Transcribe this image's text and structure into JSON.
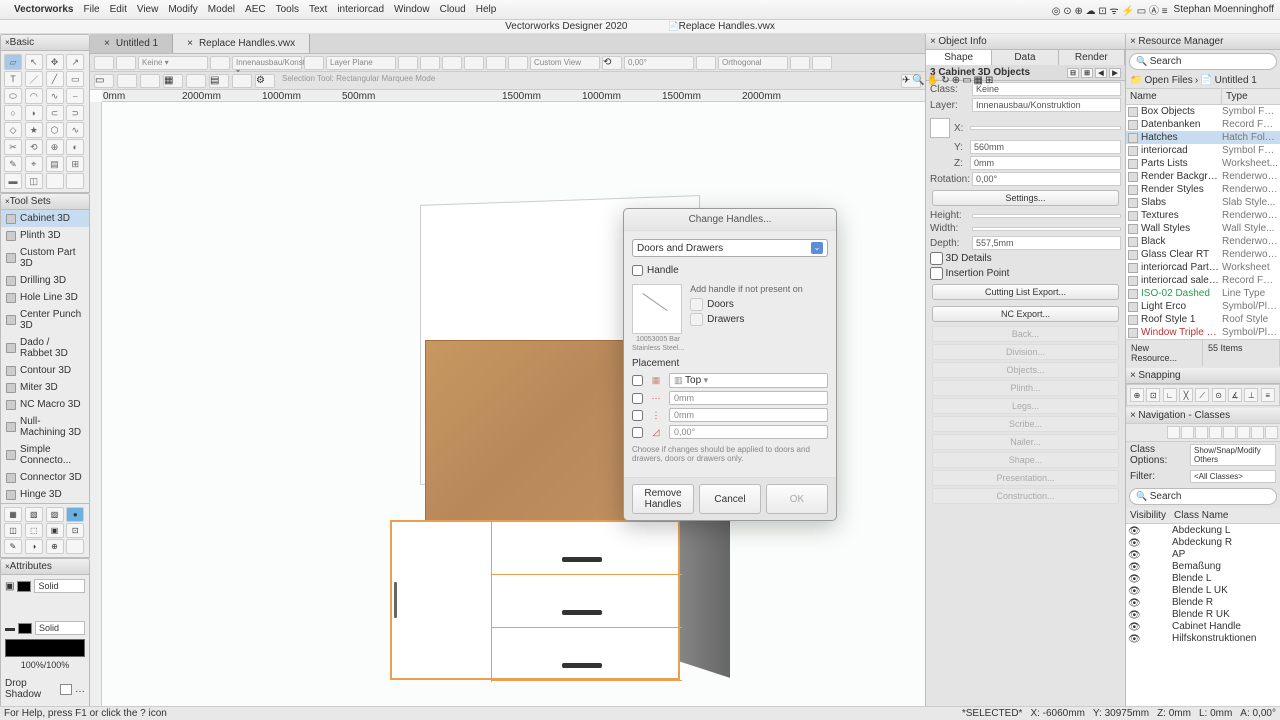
{
  "menubar": {
    "app": "Vectorworks",
    "items": [
      "File",
      "Edit",
      "View",
      "Modify",
      "Model",
      "AEC",
      "Tools",
      "Text",
      "interiorcad",
      "Window",
      "Cloud",
      "Help"
    ],
    "user": "Stephan Moenninghoff"
  },
  "titlebar": "Vectorworks Designer 2020",
  "doc_tab_title": "Replace Handles.vwx",
  "basic_palette": {
    "title": "Basic"
  },
  "toolsets": {
    "title": "Tool Sets",
    "items": [
      "Cabinet 3D",
      "Plinth 3D",
      "Custom Part 3D",
      "Drilling 3D",
      "Hole Line 3D",
      "Center Punch 3D",
      "Dado / Rabbet 3D",
      "Contour 3D",
      "Miter 3D",
      "NC Macro 3D",
      "Null-Machining 3D",
      "Simple Connecto...",
      "Connector 3D",
      "Hinge 3D"
    ]
  },
  "attributes": {
    "title": "Attributes",
    "fill": "Solid",
    "stroke": "Solid",
    "opacity": "100%/100%",
    "dropshadow": "Drop Shadow"
  },
  "tabs": [
    {
      "label": "Untitled 1"
    },
    {
      "label": "Replace Handles.vwx"
    }
  ],
  "toolbar": {
    "mode": "Selection Tool: Rectangular Marquee Mode",
    "layer_plane": "Layer Plane",
    "custom_view": "Custom View",
    "angle": "0,00°",
    "ortho": "Orthogonal"
  },
  "ruler_marks": [
    "0mm",
    "2000mm",
    "1000mm",
    "500mm",
    "1500mm",
    "1000mm",
    "1500mm",
    "2000mm"
  ],
  "dialog": {
    "title": "Change Handles...",
    "select": "Doors and Drawers",
    "handle_chk": "Handle",
    "thumb_caption1": "10053005 Bar",
    "thumb_caption2": "Stainless Steel...",
    "add_label": "Add handle if not present on",
    "opt_doors": "Doors",
    "opt_drawers": "Drawers",
    "placement": "Placement",
    "pos": "Top",
    "v1": "0mm",
    "v2": "0mm",
    "v3": "0,00°",
    "note": "Choose if changes should be applied to doors and drawers, doors or drawers only.",
    "btn_remove": "Remove Handles",
    "btn_cancel": "Cancel",
    "btn_ok": "OK"
  },
  "objinfo": {
    "title": "Object Info",
    "tabs": [
      "Shape",
      "Data",
      "Render"
    ],
    "header": "3 Cabinet 3D Objects",
    "class_k": "Class:",
    "class_v": "Keine",
    "layer_k": "Layer:",
    "layer_v": "Innenausbau/Konstruktion",
    "x_k": "X:",
    "x_v": "",
    "y_k": "Y:",
    "y_v": "560mm",
    "z_k": "Z:",
    "z_v": "0mm",
    "rot_k": "Rotation:",
    "rot_v": "0,00°",
    "settings": "Settings...",
    "h_k": "Height:",
    "w_k": "Width:",
    "d_k": "Depth:",
    "d_v": "557,5mm",
    "details": "3D Details",
    "insertion": "Insertion Point",
    "btn1": "Cutting List Export...",
    "btn2": "NC Export...",
    "grey": [
      "Back...",
      "Division...",
      "Objects...",
      "Plinth...",
      "Legs...",
      "Scribe...",
      "Nailer...",
      "Shape...",
      "Presentation...",
      "Construction..."
    ]
  },
  "resmgr": {
    "title": "Resource Manager",
    "search_ph": "Search",
    "crumb1": "Open Files",
    "crumb2": "Untitled 1",
    "col_name": "Name",
    "col_type": "Type",
    "items": [
      {
        "n": "Box Objects",
        "t": "Symbol Fol..."
      },
      {
        "n": "Datenbanken",
        "t": "Record For..."
      },
      {
        "n": "Hatches",
        "t": "Hatch Folder",
        "sel": true
      },
      {
        "n": "interiorcad",
        "t": "Symbol Fol..."
      },
      {
        "n": "Parts Lists",
        "t": "Worksheet..."
      },
      {
        "n": "Render Backgrounds",
        "t": "Renderwor..."
      },
      {
        "n": "Render Styles",
        "t": "Renderwor..."
      },
      {
        "n": "Slabs",
        "t": "Slab Style..."
      },
      {
        "n": "Textures",
        "t": "Renderwor..."
      },
      {
        "n": "Wall Styles",
        "t": "Wall Style..."
      },
      {
        "n": "Black",
        "t": "Renderwor..."
      },
      {
        "n": "Glass Clear RT",
        "t": "Renderwor..."
      },
      {
        "n": "interiorcad Parts List",
        "t": "Worksheet"
      },
      {
        "n": "interiorcad sales info",
        "t": "Record For..."
      },
      {
        "n": "ISO-02 Dashed",
        "t": "Line Type",
        "c": "green"
      },
      {
        "n": "Light Erco",
        "t": "Symbol/Plu..."
      },
      {
        "n": "Roof Style 1",
        "t": "Roof Style"
      },
      {
        "n": "Window Triple Slider",
        "t": "Symbol/Plu...",
        "c": "red"
      }
    ],
    "new_res": "New Resource...",
    "count": "55 Items"
  },
  "snapping": {
    "title": "Snapping"
  },
  "nav": {
    "title": "Navigation - Classes",
    "opts_k": "Class Options:",
    "opts_v": "Show/Snap/Modify Others",
    "filt_k": "Filter:",
    "filt_v": "<All Classes>",
    "search_ph": "Search",
    "col_vis": "Visibility",
    "col_name": "Class Name",
    "items": [
      "Abdeckung L",
      "Abdeckung R",
      "AP",
      "Bemaßung",
      "Blende L",
      "Blende L UK",
      "Blende R",
      "Blende R UK",
      "Cabinet Handle",
      "Hilfskonstruktionen"
    ]
  },
  "status": {
    "help": "For Help, press F1 or click the ? icon",
    "sel": "*SELECTED*",
    "x": "X:  -6060mm",
    "y": "Y:  30975mm",
    "z": "Z:  0mm",
    "l": "L:  0mm",
    "a": "A:  0,00°"
  }
}
